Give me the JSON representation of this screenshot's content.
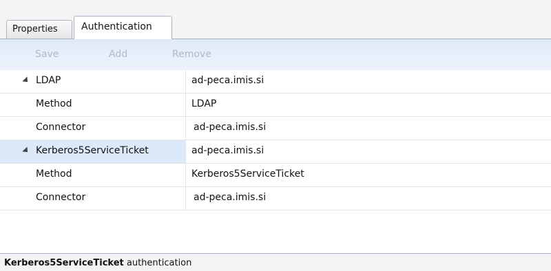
{
  "tabs": [
    {
      "label": "Properties",
      "active": false
    },
    {
      "label": "Authentication",
      "active": true
    }
  ],
  "toolbar": {
    "save_label": "Save",
    "add_label": "Add",
    "remove_label": "Remove"
  },
  "authentication": [
    {
      "name": "LDAP",
      "value": "ad-peca.imis.si",
      "selected": false,
      "method_label": "Method",
      "method_value": "LDAP",
      "connector_label": "Connector",
      "connector_value": "ad-peca.imis.si"
    },
    {
      "name": "Kerberos5ServiceTicket",
      "value": "ad-peca.imis.si",
      "selected": true,
      "method_label": "Method",
      "method_value": "Kerberos5ServiceTicket",
      "connector_label": "Connector",
      "connector_value": "ad-peca.imis.si"
    }
  ],
  "status": {
    "bold_text": "Kerberos5ServiceTicket",
    "text": " authentication"
  },
  "colors": {
    "selection": "#dce9f9",
    "toolbar": "#dfeaf8",
    "disabled_text": "#b3b9c3"
  },
  "icons": {
    "expand": "caret-expanded-icon"
  }
}
